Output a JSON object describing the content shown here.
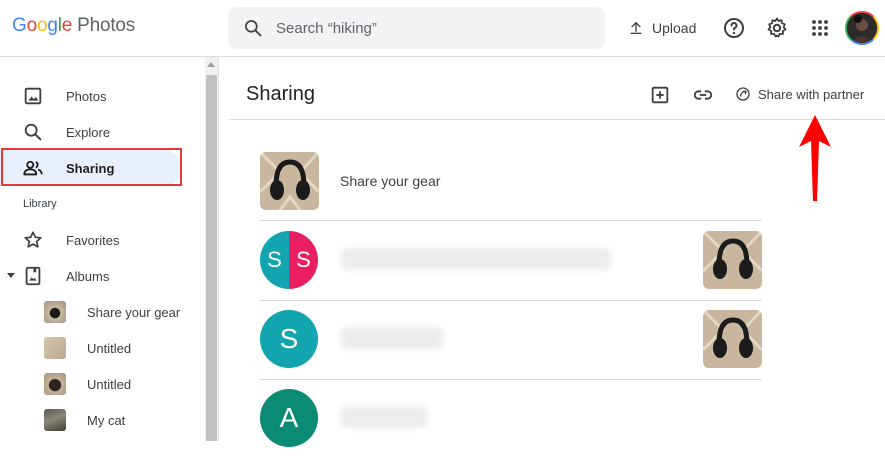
{
  "app": {
    "logo_word": "Google",
    "logo_suffix": "Photos"
  },
  "search": {
    "placeholder": "Search “hiking”"
  },
  "header": {
    "upload_label": "Upload",
    "help_icon": "help-icon",
    "settings_icon": "gear-icon",
    "apps_icon": "apps-grid-icon"
  },
  "sidebar": {
    "items": [
      {
        "label": "Photos",
        "icon": "photo-icon"
      },
      {
        "label": "Explore",
        "icon": "search-icon"
      },
      {
        "label": "Sharing",
        "icon": "people-icon",
        "active": true
      }
    ],
    "library_label": "Library",
    "library_items": [
      {
        "label": "Favorites",
        "icon": "star-icon"
      },
      {
        "label": "Albums",
        "icon": "album-icon"
      }
    ],
    "albums": [
      {
        "label": "Share your gear"
      },
      {
        "label": "Untitled"
      },
      {
        "label": "Untitled"
      },
      {
        "label": "My cat"
      }
    ]
  },
  "main": {
    "title": "Sharing",
    "actions": {
      "share_partner_label": "Share with partner"
    },
    "rows": [
      {
        "title": "Share your gear",
        "type": "album"
      },
      {
        "type": "conversation",
        "avatar_letters": [
          "S",
          "S"
        ],
        "avatar_colors": [
          "#12a4af",
          "#e91e63"
        ]
      },
      {
        "type": "conversation",
        "avatar_letters": [
          "S"
        ],
        "avatar_colors": [
          "#12a4af"
        ]
      },
      {
        "type": "conversation",
        "avatar_letters": [
          "A"
        ],
        "avatar_colors": [
          "#0b8a74"
        ]
      }
    ]
  },
  "colors": {
    "accent": "#1a73e8",
    "active_bg": "#e8f0fe",
    "annotation_red": "#e53935",
    "arrow_red": "#ff0000"
  }
}
